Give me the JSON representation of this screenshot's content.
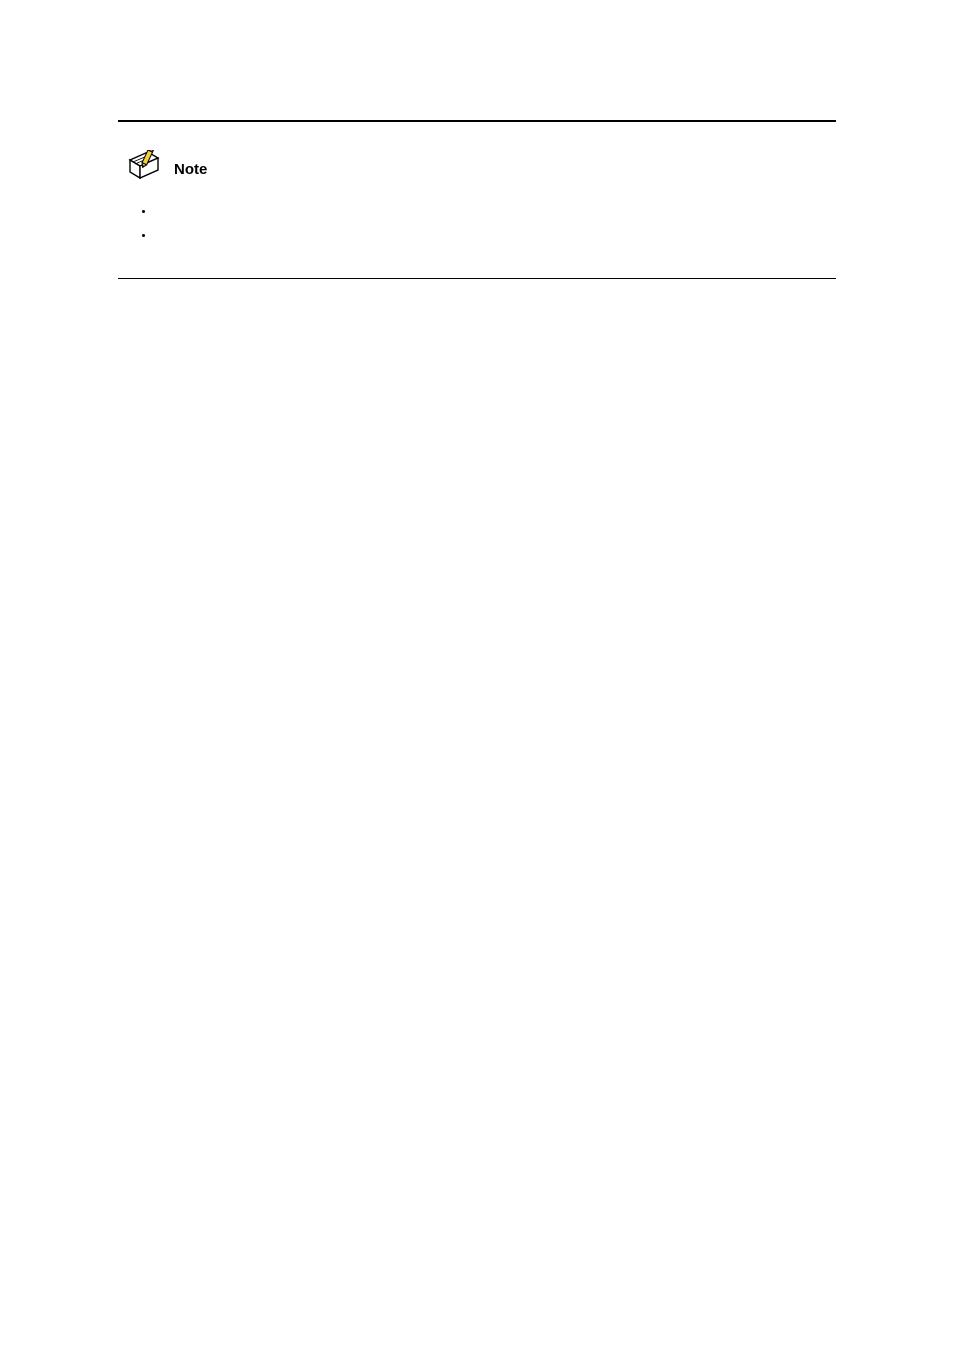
{
  "noteLabel": "Note",
  "bullet1": "",
  "bullet2": "",
  "footer": ""
}
